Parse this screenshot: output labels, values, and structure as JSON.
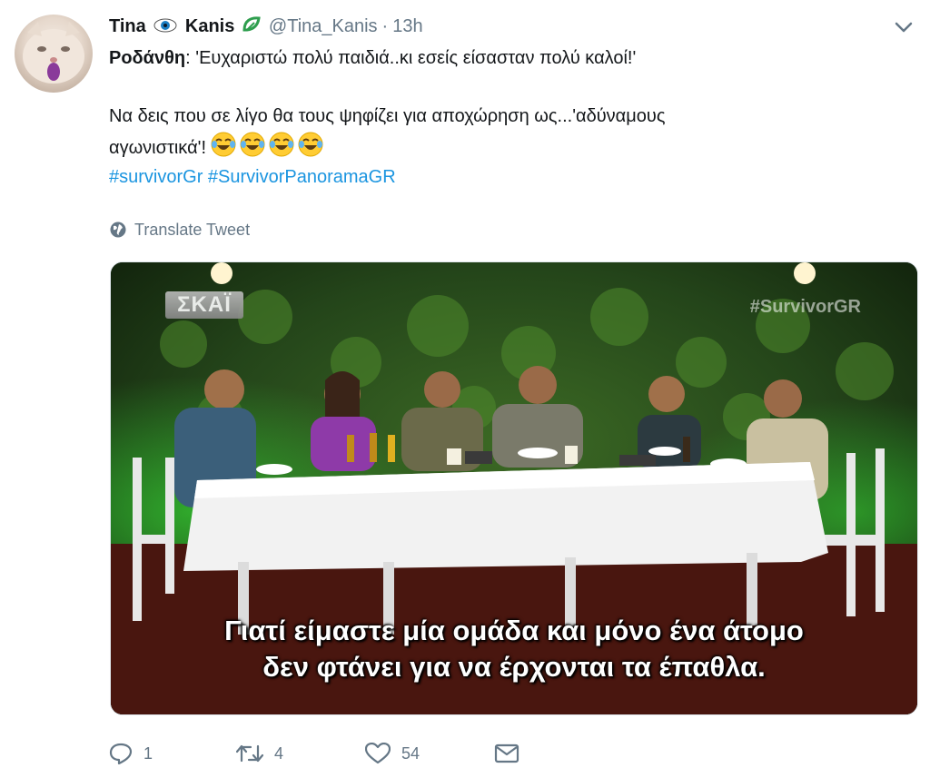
{
  "tweet": {
    "display_name_part1": "Tina",
    "display_name_part2": "Kanis",
    "handle": "@Tina_Kanis",
    "separator": "·",
    "time": "13h",
    "speaker": "Ροδάνθη",
    "line1": ": 'Ευχαριστώ πολύ παιδιά..κι εσείς είσασταν πολύ καλοί!'",
    "line2": "Να δεις που σε λίγο θα τους ψηφίζει για αποχώρηση ως...'αδύναμους",
    "line3": "αγωνιστικά'!",
    "emoji": "face-with-tears-of-joy x4",
    "hashtags": [
      "#survivorGr",
      "#SurvivorPanoramaGR"
    ],
    "translate_label": "Translate Tweet"
  },
  "media": {
    "channel_logo": "ΣΚΑΪ",
    "watermark": "#SurvivorGR",
    "subtitle_line1": "Γιατί είμαστε μία ομάδα και μόνο ένα άτομο",
    "subtitle_line2": "δεν φτάνει για να έρχονται τα έπαθλα."
  },
  "actions": {
    "reply_count": "1",
    "retweet_count": "4",
    "like_count": "54"
  },
  "icons": [
    "eye-icon",
    "tree-icon",
    "caret-down-icon",
    "globe-icon",
    "reply-icon",
    "retweet-icon",
    "heart-icon",
    "message-icon"
  ],
  "colors": {
    "text": "#14171a",
    "secondary": "#657786",
    "link": "#1b95e0"
  }
}
